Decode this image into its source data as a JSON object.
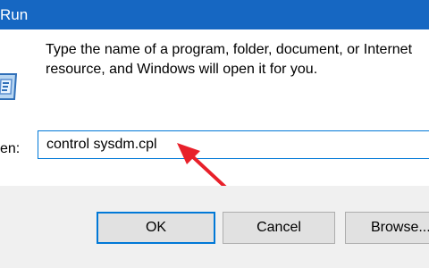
{
  "window": {
    "title": "Run"
  },
  "dialog": {
    "description_line1": "Type the name of a program, folder, document, or Internet",
    "description_line2": "resource, and Windows will open it for you.",
    "open_label": "en:",
    "open_value": "control sysdm.cpl"
  },
  "annotation": {
    "icon": "red-arrow-icon",
    "color": "#e8202a"
  },
  "buttons": {
    "ok": "OK",
    "cancel": "Cancel",
    "browse": "Browse..."
  }
}
